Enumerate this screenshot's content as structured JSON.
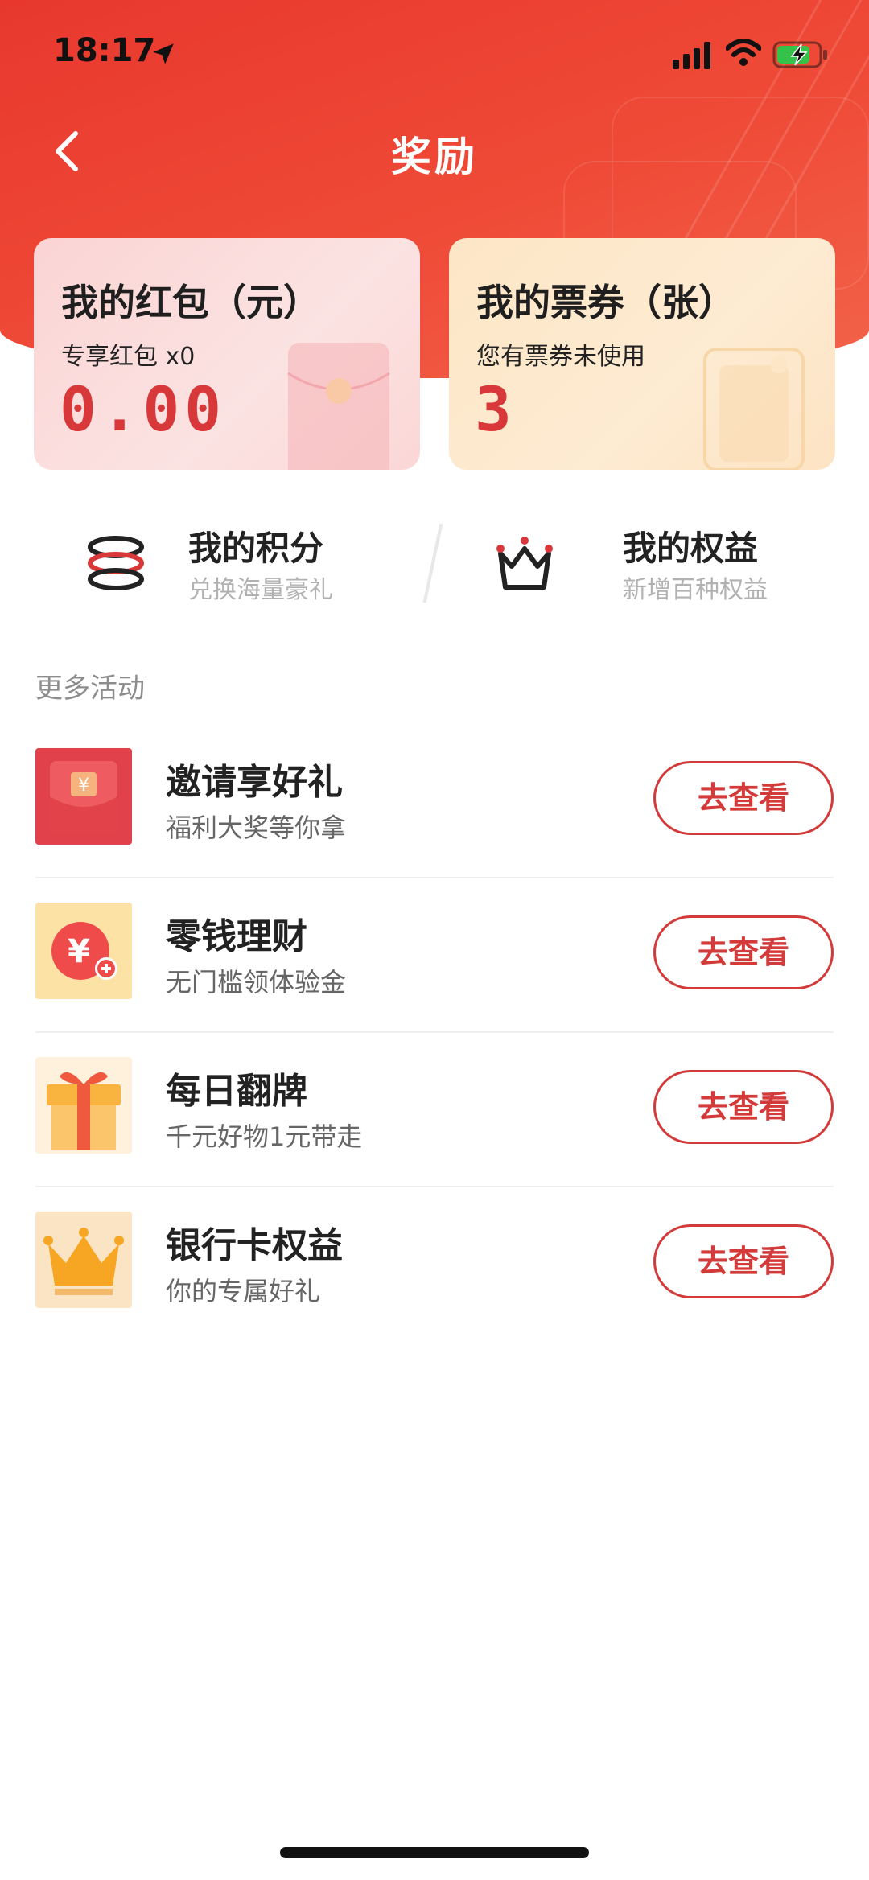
{
  "status_bar": {
    "time": "18:17"
  },
  "header": {
    "title": "奖励"
  },
  "cards": {
    "red_packet": {
      "title": "我的红包（元）",
      "subtitle": "专享红包 x0",
      "value": "0.00"
    },
    "tickets": {
      "title": "我的票券（张）",
      "subtitle": "您有票券未使用",
      "value": "3"
    }
  },
  "quick": {
    "points": {
      "title": "我的积分",
      "subtitle": "兑换海量豪礼"
    },
    "rights": {
      "title": "我的权益",
      "subtitle": "新增百种权益"
    }
  },
  "section": {
    "label": "更多活动"
  },
  "activities": [
    {
      "title": "邀请享好礼",
      "subtitle": "福利大奖等你拿",
      "button": "去查看"
    },
    {
      "title": "零钱理财",
      "subtitle": "无门槛领体验金",
      "button": "去查看"
    },
    {
      "title": "每日翻牌",
      "subtitle": "千元好物1元带走",
      "button": "去查看"
    },
    {
      "title": "银行卡权益",
      "subtitle": "你的专属好礼",
      "button": "去查看"
    }
  ],
  "colors": {
    "brand_red": "#e8382e",
    "accent_red": "#d33a3a"
  }
}
